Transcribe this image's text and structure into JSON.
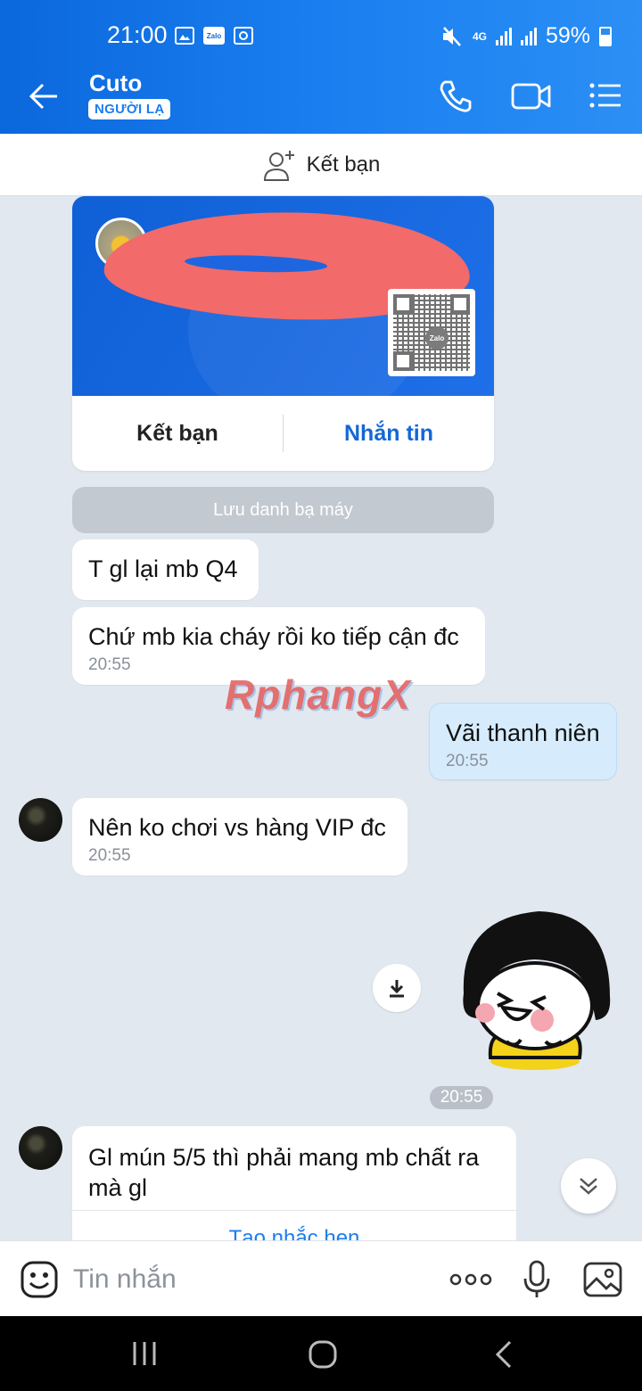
{
  "status_bar": {
    "time": "21:00",
    "network": "4G",
    "battery": "59%"
  },
  "header": {
    "title": "Cuto",
    "badge": "NGƯỜI LẠ",
    "icons": [
      "back-arrow-icon",
      "phone-icon",
      "video-call-icon",
      "menu-list-icon"
    ]
  },
  "friend_bar": {
    "label": "Kết bạn"
  },
  "profile_card": {
    "add_friend_label": "Kết bạn",
    "message_label": "Nhắn tin",
    "qr_logo": "Zalo"
  },
  "save_contact": {
    "label": "Lưu danh bạ máy"
  },
  "messages": [
    {
      "from": "them",
      "text": "T gl lại mb Q4",
      "time": ""
    },
    {
      "from": "them",
      "text": "Chứ mb kia cháy rồi ko tiếp cận đc",
      "time": "20:55"
    },
    {
      "from": "me",
      "text": "Vãi thanh niên",
      "time": "20:55"
    },
    {
      "from": "them",
      "text": "Nên ko chơi vs hàng VIP đc",
      "time": "20:55"
    },
    {
      "from": "them",
      "text": "Gl mún 5/5 thì phải mang mb chất ra mà gl",
      "time": ""
    }
  ],
  "watermark": "RphangX",
  "sticker_time": "20:55",
  "reminder_link": "Tạo nhắc hẹn",
  "input": {
    "placeholder": "Tin nhắn"
  },
  "colors": {
    "header_blue": "#1a7ef0",
    "my_bubble": "#d6ecfd",
    "chat_bg": "#e2e8f0",
    "link_blue": "#1468d6"
  }
}
